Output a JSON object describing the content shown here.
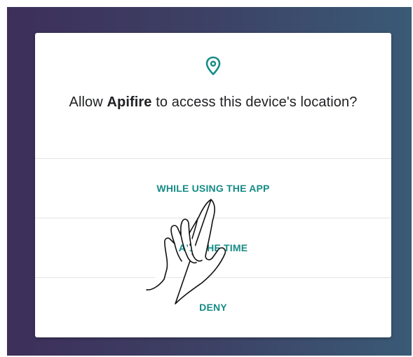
{
  "dialog": {
    "icon": "location-pin-icon",
    "title_prefix": "Allow ",
    "app_name": "Apifire",
    "title_suffix": " to access this device's location?",
    "options": [
      {
        "label": "WHILE USING THE APP"
      },
      {
        "label": "ALL THE TIME"
      },
      {
        "label": "DENY"
      }
    ]
  },
  "overlay": {
    "icon": "pointing-hand-icon"
  },
  "colors": {
    "accent": "#168b86",
    "background_left": "#3d2f5a",
    "background_right": "#3a5a76"
  }
}
